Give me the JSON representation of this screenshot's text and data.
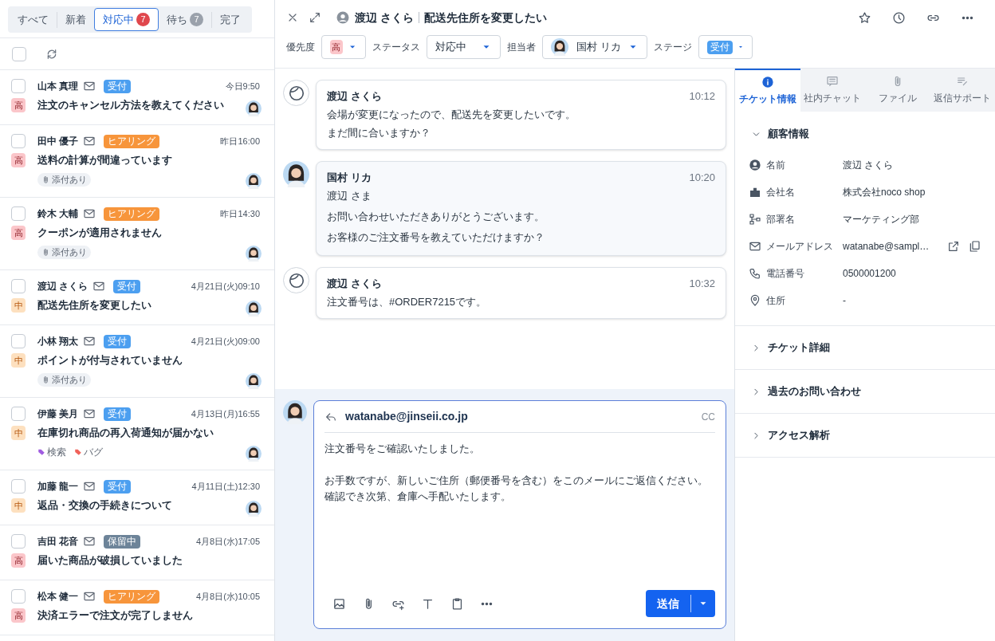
{
  "list_tabs": [
    {
      "label": "すべて",
      "selected": false
    },
    {
      "label": "新着",
      "selected": false
    },
    {
      "label": "対応中",
      "selected": true,
      "count": {
        "text": "7",
        "color": "#e0474c"
      }
    },
    {
      "label": "待ち",
      "selected": false,
      "count": {
        "text": "7",
        "color": "#9aa1ab"
      }
    },
    {
      "label": "完了",
      "selected": false
    }
  ],
  "list_toolbar": {
    "select_all_checked": false
  },
  "tickets": [
    {
      "checked": false,
      "name": "山本 真理",
      "status": {
        "label": "受付",
        "color": "#4c9ff0"
      },
      "time": "今日9:50",
      "priority": {
        "label": "高",
        "kind": "high"
      },
      "subject": "注文のキャンセル方法を教えてください",
      "assignee": true
    },
    {
      "checked": false,
      "name": "田中 優子",
      "status": {
        "label": "ヒアリング",
        "color": "#f7953b"
      },
      "time": "昨日16:00",
      "priority": {
        "label": "高",
        "kind": "high"
      },
      "subject": "送料の計算が間違っています",
      "tags": [
        {
          "kind": "attachment",
          "label": "添付あり"
        }
      ],
      "assignee": true
    },
    {
      "checked": false,
      "name": "鈴木 大輔",
      "status": {
        "label": "ヒアリング",
        "color": "#f7953b"
      },
      "time": "昨日14:30",
      "priority": {
        "label": "高",
        "kind": "high"
      },
      "subject": "クーポンが適用されません",
      "tags": [
        {
          "kind": "attachment",
          "label": "添付あり"
        }
      ],
      "assignee": true
    },
    {
      "checked": false,
      "name": "渡辺 さくら",
      "status": {
        "label": "受付",
        "color": "#4c9ff0"
      },
      "time": "4月21日(火)09:10",
      "priority": {
        "label": "中",
        "kind": "medium"
      },
      "subject": "配送先住所を変更したい",
      "assignee": true
    },
    {
      "checked": false,
      "name": "小林 翔太",
      "status": {
        "label": "受付",
        "color": "#4c9ff0"
      },
      "time": "4月21日(火)09:00",
      "priority": {
        "label": "中",
        "kind": "medium"
      },
      "subject": "ポイントが付与されていません",
      "tags": [
        {
          "kind": "attachment",
          "label": "添付あり"
        }
      ],
      "assignee": true
    },
    {
      "checked": false,
      "name": "伊藤 美月",
      "status": {
        "label": "受付",
        "color": "#4c9ff0"
      },
      "time": "4月13日(月)16:55",
      "priority": {
        "label": "中",
        "kind": "medium"
      },
      "subject": "在庫切れ商品の再入荷通知が届かない",
      "tags": [
        {
          "kind": "label",
          "label": "検索",
          "color": "#a05ce0"
        },
        {
          "kind": "label",
          "label": "バグ",
          "color": "#f0625a"
        }
      ],
      "assignee": true
    },
    {
      "checked": false,
      "name": "加藤 龍一",
      "status": {
        "label": "受付",
        "color": "#4c9ff0"
      },
      "time": "4月11日(土)12:30",
      "priority": {
        "label": "中",
        "kind": "medium"
      },
      "subject": "返品・交換の手続きについて",
      "assignee": true
    },
    {
      "checked": false,
      "name": "吉田 花音",
      "status": {
        "label": "保留中",
        "color": "#6d8499"
      },
      "time": "4月8日(水)17:05",
      "priority": {
        "label": "高",
        "kind": "high"
      },
      "subject": "届いた商品が破損していました",
      "assignee": false
    },
    {
      "checked": false,
      "name": "松本 健一",
      "status": {
        "label": "ヒアリング",
        "color": "#f7953b"
      },
      "time": "4月8日(水)10:05",
      "priority": {
        "label": "高",
        "kind": "high"
      },
      "subject": "決済エラーで注文が完了しません",
      "assignee": false
    }
  ],
  "ticket_header": {
    "customer": "渡辺 さくら",
    "subject": "配送先住所を変更したい"
  },
  "ticket_fields": {
    "priority_label": "優先度",
    "priority": {
      "label": "高",
      "kind": "high"
    },
    "status_label": "ステータス",
    "status": "対応中",
    "assignee_label": "担当者",
    "assignee": "国村 リカ",
    "stage_label": "ステージ",
    "stage": {
      "label": "受付",
      "color": "#4c9ff0"
    }
  },
  "messages": [
    {
      "kind": "customer",
      "author": "渡辺 さくら",
      "time": "10:12",
      "lines": [
        "会場が変更になったので、配送先を変更したいです。",
        "まだ間に合いますか？"
      ]
    },
    {
      "kind": "agent",
      "author": "国村 リカ",
      "time": "10:20",
      "lines": [
        "渡辺 さま",
        "お問い合わせいただきありがとうございます。",
        "お客様のご注文番号を教えていただけますか？"
      ]
    },
    {
      "kind": "customer",
      "author": "渡辺 さくら",
      "time": "10:32",
      "lines": [
        "注文番号は、#ORDER7215です。"
      ]
    }
  ],
  "composer": {
    "to": "watanabe@jinseii.co.jp",
    "cc": "CC",
    "paragraphs": [
      "注文番号をご確認いたしました。",
      "お手数ですが、新しいご住所（郵便番号を含む）をこのメールにご返信ください。確認でき次第、倉庫へ手配いたします。"
    ],
    "send": "送信"
  },
  "side_tabs": [
    {
      "label": "チケット情報",
      "selected": true
    },
    {
      "label": "社内チャット",
      "selected": false
    },
    {
      "label": "ファイル",
      "selected": false
    },
    {
      "label": "返信サポート",
      "selected": false
    }
  ],
  "sections": [
    {
      "title": "顧客情報",
      "expanded": true,
      "fields": [
        {
          "label": "名前",
          "value": "渡辺 さくら"
        },
        {
          "label": "会社名",
          "value": "株式会社noco shop"
        },
        {
          "label": "部署名",
          "value": "マーケティング部"
        },
        {
          "label": "メールアドレス",
          "value": "watanabe@sampl…",
          "actions": true
        },
        {
          "label": "電話番号",
          "value": "0500001200"
        },
        {
          "label": "住所",
          "value": "-"
        }
      ]
    },
    {
      "title": "チケット詳細",
      "expanded": false
    },
    {
      "title": "過去のお問い合わせ",
      "expanded": false
    },
    {
      "title": "アクセス解析",
      "expanded": false
    }
  ]
}
